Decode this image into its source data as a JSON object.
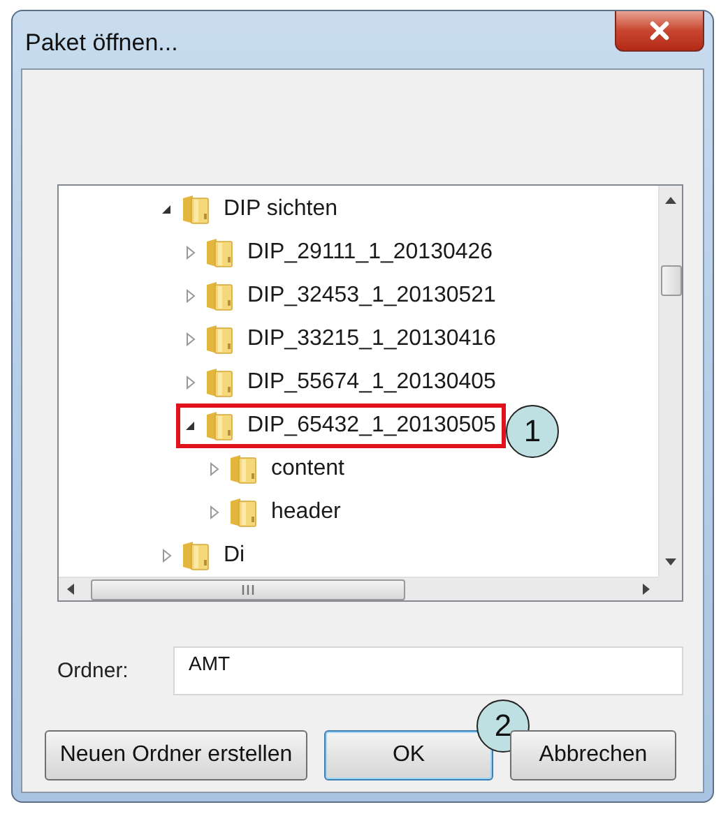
{
  "window": {
    "title": "Paket öffnen..."
  },
  "tree": [
    {
      "label": "DIP sichten",
      "expanded": true,
      "highlighted": false,
      "children": [
        {
          "label": "DIP_29111_1_20130426",
          "expanded": false,
          "highlighted": false
        },
        {
          "label": "DIP_32453_1_20130521",
          "expanded": false,
          "highlighted": false
        },
        {
          "label": "DIP_33215_1_20130416",
          "expanded": false,
          "highlighted": false
        },
        {
          "label": "DIP_55674_1_20130405",
          "expanded": false,
          "highlighted": false
        },
        {
          "label": "DIP_65432_1_20130505",
          "expanded": true,
          "highlighted": true,
          "callout": "1",
          "children": [
            {
              "label": "content",
              "expanded": false,
              "highlighted": false
            },
            {
              "label": "header",
              "expanded": false,
              "highlighted": false
            }
          ]
        }
      ]
    },
    {
      "label": "Di",
      "expanded": false,
      "highlighted": false
    }
  ],
  "folder_field": {
    "label": "Ordner:",
    "value": "AMT"
  },
  "buttons": [
    {
      "label": "Neuen Ordner erstellen",
      "default": false
    },
    {
      "label": "OK",
      "default": true,
      "callout": "2"
    },
    {
      "label": "Abbrechen",
      "default": false
    }
  ]
}
